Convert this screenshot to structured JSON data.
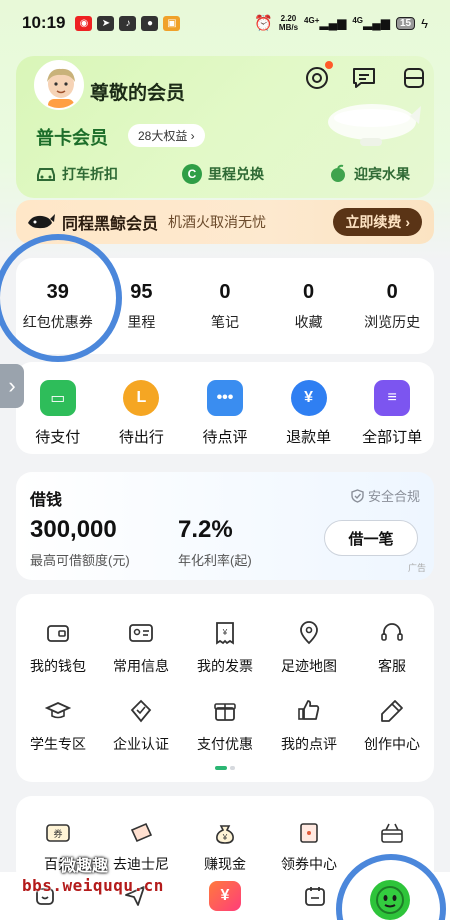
{
  "status_bar": {
    "time": "10:19",
    "speed_value": "2.20",
    "speed_unit": "MB/s",
    "signal1": "4G+",
    "signal2": "4G",
    "battery": "15"
  },
  "member": {
    "title": "尊敬的会员",
    "level": "普卡会员",
    "rights_badge": "28大权益 ›",
    "benefits": [
      "打车折扣",
      "里程兑换",
      "迎宾水果"
    ]
  },
  "whale": {
    "title": "同程黑鲸会员",
    "subtitle": "机酒火取消无忧",
    "button": "立即续费 ›"
  },
  "stats": [
    {
      "num": "39",
      "label": "红包优惠券"
    },
    {
      "num": "95",
      "label": "里程"
    },
    {
      "num": "0",
      "label": "笔记"
    },
    {
      "num": "0",
      "label": "收藏"
    },
    {
      "num": "0",
      "label": "浏览历史"
    }
  ],
  "orders": [
    {
      "label": "待支付",
      "color": "#2ebd5a",
      "icon": "wallet-icon"
    },
    {
      "label": "待出行",
      "color": "#f5a623",
      "icon": "clock-icon"
    },
    {
      "label": "待点评",
      "color": "#3a8df0",
      "icon": "chat-icon"
    },
    {
      "label": "退款单",
      "color": "#2f7ff2",
      "icon": "yen-icon"
    },
    {
      "label": "全部订单",
      "color": "#7c55f0",
      "icon": "list-icon"
    }
  ],
  "loan": {
    "title": "借钱",
    "safe": "安全合规",
    "amount": "300,000",
    "amount_label": "最高可借额度(元)",
    "rate": "7.2%",
    "rate_label": "年化利率(起)",
    "button": "借一笔",
    "ad": "广告"
  },
  "tools": [
    {
      "label": "我的钱包",
      "icon": "wallet-icon"
    },
    {
      "label": "常用信息",
      "icon": "id-card-icon"
    },
    {
      "label": "我的发票",
      "icon": "invoice-icon"
    },
    {
      "label": "足迹地图",
      "icon": "map-pin-icon"
    },
    {
      "label": "客服",
      "icon": "headset-icon"
    },
    {
      "label": "学生专区",
      "icon": "graduation-cap-icon"
    },
    {
      "label": "企业认证",
      "icon": "verified-icon"
    },
    {
      "label": "支付优惠",
      "icon": "gift-icon"
    },
    {
      "label": "我的点评",
      "icon": "thumbs-up-icon"
    },
    {
      "label": "创作中心",
      "icon": "pen-icon"
    }
  ],
  "promos": [
    {
      "label": "百元",
      "icon": "coupon-icon"
    },
    {
      "label": "去迪士尼",
      "icon": "ticket-icon"
    },
    {
      "label": "赚现金",
      "icon": "money-bag-icon"
    },
    {
      "label": "领券中心",
      "icon": "voucher-icon"
    },
    {
      "label": "",
      "icon": "basket-icon"
    }
  ],
  "watermark": {
    "line1": "微趣趣",
    "line2": "bbs.weiququ.cn"
  },
  "accent_ring_color": "#4b87db"
}
